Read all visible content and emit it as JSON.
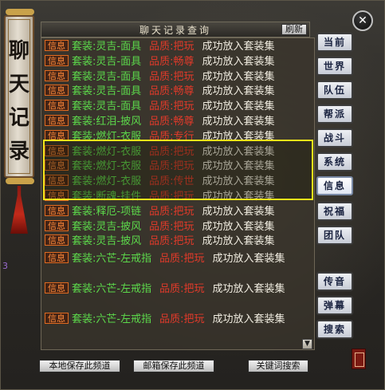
{
  "window": {
    "close_icon": "✕",
    "scroll_title": [
      "聊",
      "天",
      "记",
      "录"
    ],
    "side_number": "3"
  },
  "panel": {
    "title": "聊天记录查询",
    "refresh_label": "刷新",
    "scroll_down_icon": "chevron-down-icon"
  },
  "log": [
    {
      "tag": "信息",
      "item": "套装:灵吉-面具",
      "qual": "品质:把玩",
      "msg": "成功放入套装集"
    },
    {
      "tag": "信息",
      "item": "套装:灵吉-面具",
      "qual": "品质:畅尊",
      "msg": "成功放入套装集"
    },
    {
      "tag": "信息",
      "item": "套装:灵吉-面具",
      "qual": "品质:把玩",
      "msg": "成功放入套装集"
    },
    {
      "tag": "信息",
      "item": "套装:灵吉-面具",
      "qual": "品质:畅尊",
      "msg": "成功放入套装集"
    },
    {
      "tag": "信息",
      "item": "套装:灵吉-面具",
      "qual": "品质:把玩",
      "msg": "成功放入套装集"
    },
    {
      "tag": "信息",
      "item": "套装:红泪-披风",
      "qual": "品质:畅尊",
      "msg": "成功放入套装集"
    },
    {
      "tag": "信息",
      "item": "套装:燃灯-衣服",
      "qual": "品质:专行",
      "msg": "成功放入套装集"
    },
    {
      "tag": "信息",
      "item": "套装:燃灯-衣服",
      "qual": "品质:把玩",
      "msg": "成功放入套装集"
    },
    {
      "tag": "信息",
      "item": "套装:燃灯-衣服",
      "qual": "品质:把玩",
      "msg": "成功放入套装集"
    },
    {
      "tag": "信息",
      "item": "套装:燃灯-衣服",
      "qual": "品质:传世",
      "msg": "成功放入套装集"
    },
    {
      "tag": "信息",
      "item": "套装:断魂-挂件",
      "qual": "品质:把玩",
      "msg": "成功放入套装集"
    },
    {
      "tag": "信息",
      "item": "套装:释厄-项链",
      "qual": "品质:把玩",
      "msg": "成功放入套装集"
    },
    {
      "tag": "信息",
      "item": "套装:灵吉-披风",
      "qual": "品质:把玩",
      "msg": "成功放入套装集"
    },
    {
      "tag": "信息",
      "item": "套装:灵吉-披风",
      "qual": "品质:把玩",
      "msg": "成功放入套装集"
    }
  ],
  "log_wrapped": [
    {
      "tag": "信息",
      "item": "套装:六芒-左戒指",
      "qual": "品质:把玩",
      "msg": "成功放入套装集"
    },
    {
      "tag": "信息",
      "item": "套装:六芒-左戒指",
      "qual": "品质:把玩",
      "msg": "成功放入套装集"
    },
    {
      "tag": "信息",
      "item": "套装:六芒-左戒指",
      "qual": "品质:把玩",
      "msg": "成功放入套装集"
    }
  ],
  "channels": [
    "当前",
    "世界",
    "队伍",
    "帮派",
    "战斗",
    "系统",
    "信息",
    "祝福",
    "团队",
    "传音",
    "弹幕",
    "搜索"
  ],
  "active_channel": "信息",
  "bottom_buttons": {
    "save_local": "本地保存此频道",
    "save_mail": "邮箱保存此频道",
    "keyword_search": "关键词搜索"
  },
  "colors": {
    "item_green": "#5cd94b",
    "quality_red": "#e23a2a",
    "tag_orange": "#ff8a3a",
    "highlight_yellow": "#f2e419"
  }
}
